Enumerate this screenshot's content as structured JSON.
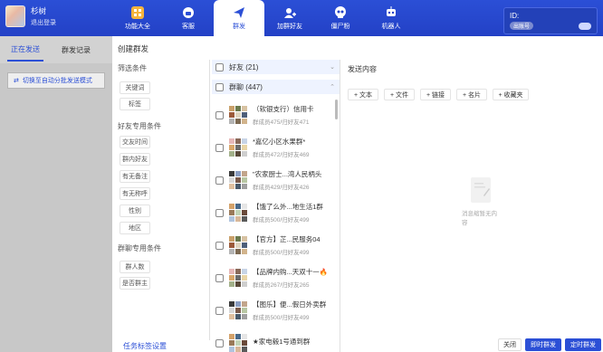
{
  "user": {
    "name": "杉树",
    "logout": "退出登录"
  },
  "nav": [
    {
      "label": "功能大全",
      "icon": "grid-icon",
      "active": false
    },
    {
      "label": "客服",
      "icon": "headset-icon",
      "active": false
    },
    {
      "label": "群发",
      "icon": "send-icon",
      "active": true
    },
    {
      "label": "加群好友",
      "icon": "add-user-icon",
      "active": false
    },
    {
      "label": "僵尸粉",
      "icon": "skull-icon",
      "active": false
    },
    {
      "label": "机器人",
      "icon": "robot-icon",
      "active": false
    }
  ],
  "account": {
    "id_label": "ID:",
    "badge": "出账号"
  },
  "left_panel": {
    "tabs": [
      "正在发送",
      "群发记录"
    ],
    "mode_button": "切换至自动分批发送模式"
  },
  "modal": {
    "title": "创建群发",
    "filter": {
      "heading": "筛选条件",
      "general": [
        "关键词",
        "标签"
      ],
      "friend_heading": "好友专用条件",
      "friend": [
        "交友时间",
        "群内好友",
        "有无备注",
        "有无称呼",
        "性别",
        "地区"
      ],
      "group_heading": "群聊专用条件",
      "group": [
        "群人数",
        "是否群主"
      ]
    },
    "list": {
      "friends_group": "好友 (21)",
      "groups_group": "群聊 (447)",
      "items": [
        {
          "title": "（软银支行）信用卡",
          "sub": "群成员475/归好友471"
        },
        {
          "title": "*嘉亿小区水果群*",
          "sub": "群成员472/归好友469"
        },
        {
          "title": "\"农家厨士...湾人民柄头",
          "sub": "群成员429/归好友426"
        },
        {
          "title": "【饿了么外...地生活1群",
          "sub": "群成员500/归好友499"
        },
        {
          "title": "【官方】芷...民服务04",
          "sub": "群成员500/归好友499"
        },
        {
          "title": "【品牌内购...天双十一🔥",
          "sub": "群成员267/归好友265"
        },
        {
          "title": "【图乐】便...假日外卖群",
          "sub": "群成员500/归好友499"
        },
        {
          "title": "★家电毂1号通到群",
          "sub": ""
        }
      ]
    },
    "content": {
      "title": "发送内容",
      "buttons": [
        "+ 文本",
        "+ 文件",
        "+ 链接",
        "+ 名片",
        "+ 收藏夹"
      ],
      "empty": "消息缩暂无内容"
    },
    "footer": {
      "settings_link": "任务标签设置",
      "close": "关闭",
      "send_now": "即时群发",
      "send_timed": "定时群发"
    }
  },
  "colors": {
    "primary": "#2b4fd6",
    "header": "#2341c6"
  }
}
